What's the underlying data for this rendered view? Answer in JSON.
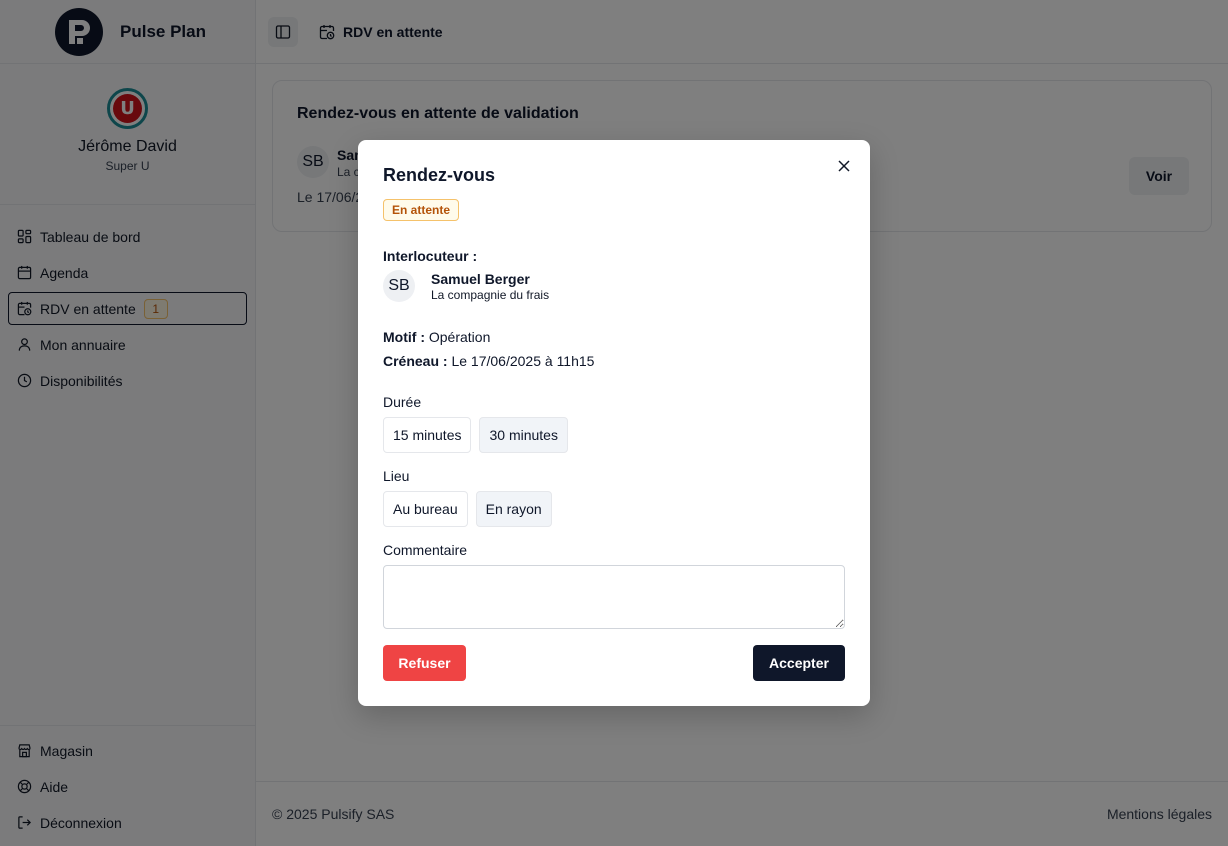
{
  "brand": {
    "name": "Pulse Plan",
    "logo": "pulse-plan-logo"
  },
  "profile": {
    "name": "Jérôme David",
    "store": "Super U",
    "store_logo_letter": "U"
  },
  "nav": {
    "items": [
      {
        "label": "Tableau de bord",
        "icon": "dashboard-icon"
      },
      {
        "label": "Agenda",
        "icon": "calendar-icon"
      },
      {
        "label": "RDV en attente",
        "icon": "calendar-clock-icon",
        "badge": "1",
        "active": true
      },
      {
        "label": "Mon annuaire",
        "icon": "user-icon"
      },
      {
        "label": "Disponibilités",
        "icon": "clock-icon"
      }
    ],
    "bottom": [
      {
        "label": "Magasin",
        "icon": "store-icon"
      },
      {
        "label": "Aide",
        "icon": "help-buoy-icon"
      },
      {
        "label": "Déconnexion",
        "icon": "logout-icon"
      }
    ]
  },
  "topbar": {
    "breadcrumb": "RDV en attente"
  },
  "card": {
    "title": "Rendez-vous en attente de validation",
    "avatar": "SB",
    "person": "Sam",
    "company": "La c",
    "date": "Le 17/06/2",
    "button": "Voir"
  },
  "footer": {
    "copyright": "© 2025 Pulsify SAS",
    "legal": "Mentions légales"
  },
  "modal": {
    "title": "Rendez-vous",
    "status": "En attente",
    "interlocutor_label": "Interlocuteur :",
    "avatar": "SB",
    "person": "Samuel Berger",
    "company": "La compagnie du frais",
    "motif_label": "Motif :",
    "motif_value": "Opération",
    "slot_label": "Créneau :",
    "slot_value": "Le 17/06/2025 à 11h15",
    "duration_label": "Durée",
    "durations": [
      "15 minutes",
      "30 minutes"
    ],
    "duration_selected": "30 minutes",
    "place_label": "Lieu",
    "places": [
      "Au bureau",
      "En rayon"
    ],
    "place_selected": "En rayon",
    "comment_label": "Commentaire",
    "comment_value": "",
    "refuse": "Refuser",
    "accept": "Accepter"
  },
  "colors": {
    "primary": "#0f172a",
    "danger": "#ef4444",
    "pending": "#b45309",
    "pending_bg": "#fffbeb"
  }
}
